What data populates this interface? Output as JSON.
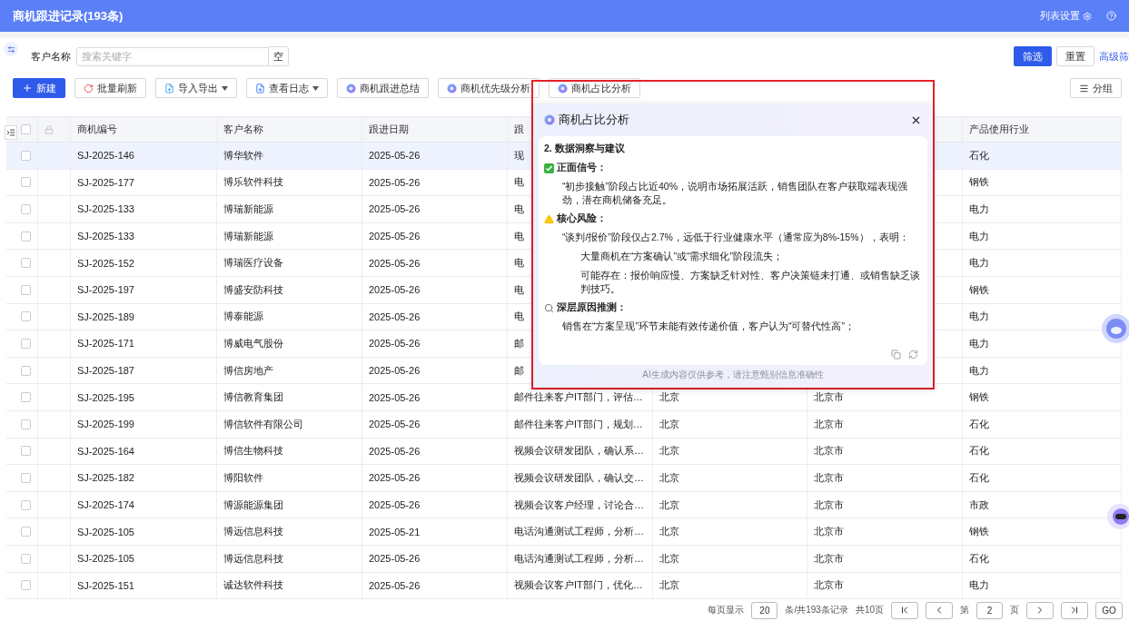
{
  "header": {
    "title": "商机跟进记录(193条)",
    "settings": "列表设置"
  },
  "filter": {
    "label": "客户名称",
    "placeholder": "搜索关键字",
    "clear": "空",
    "apply": "筛选",
    "reset": "重置",
    "advanced": "高级筛"
  },
  "toolbar": {
    "buttons": [
      {
        "kind": "primary",
        "label": "新建"
      },
      {
        "kind": "refresh",
        "label": "批量刷新"
      },
      {
        "kind": "import",
        "label": "导入导出",
        "menu": true
      },
      {
        "kind": "log",
        "label": "查看日志",
        "menu": true
      },
      {
        "kind": "ai",
        "label": "商机跟进总结"
      },
      {
        "kind": "ai",
        "label": "商机优先级分析"
      },
      {
        "kind": "ai",
        "label": "商机占比分析"
      }
    ],
    "group": "分组"
  },
  "table": {
    "header_checked": false,
    "columns": {
      "id": "商机编号",
      "customer": "客户名称",
      "date": "跟进日期",
      "column_4": "跟",
      "industry": "产品使用行业"
    },
    "rows": [
      {
        "checked": false,
        "selected": true,
        "id": "SJ-2025-146",
        "customer": "博华软件",
        "date": "2025-05-26",
        "column_4": "现",
        "industry": "石化"
      },
      {
        "checked": false,
        "selected": false,
        "id": "SJ-2025-177",
        "customer": "博乐软件科技",
        "date": "2025-05-26",
        "column_4": "电",
        "industry": "钢铁"
      },
      {
        "checked": false,
        "selected": false,
        "id": "SJ-2025-133",
        "customer": "博瑞新能源",
        "date": "2025-05-26",
        "column_4": "电",
        "industry": "电力"
      },
      {
        "checked": false,
        "selected": false,
        "id": "SJ-2025-133",
        "customer": "博瑞新能源",
        "date": "2025-05-26",
        "column_4": "电",
        "industry": "电力"
      },
      {
        "checked": false,
        "selected": false,
        "id": "SJ-2025-152",
        "customer": "博瑞医疗设备",
        "date": "2025-05-26",
        "column_4": "电",
        "industry": "电力"
      },
      {
        "checked": false,
        "selected": false,
        "id": "SJ-2025-197",
        "customer": "博盛安防科技",
        "date": "2025-05-26",
        "column_4": "电",
        "industry": "钢铁"
      },
      {
        "checked": false,
        "selected": false,
        "id": "SJ-2025-189",
        "customer": "博泰能源",
        "date": "2025-05-26",
        "column_4": "电",
        "industry": "电力"
      },
      {
        "checked": false,
        "selected": false,
        "id": "SJ-2025-171",
        "customer": "博威电气股份",
        "date": "2025-05-26",
        "column_4": "邮",
        "industry": "电力"
      },
      {
        "checked": false,
        "selected": false,
        "id": "SJ-2025-187",
        "customer": "博信房地产",
        "date": "2025-05-26",
        "column_4": "邮",
        "industry": "电力"
      },
      {
        "checked": false,
        "selected": false,
        "id": "SJ-2025-195",
        "customer": "博信教育集团",
        "date": "2025-05-26",
        "column_4": "邮件往来客户IT部门，评估…",
        "column_5": "北京",
        "column_6": "北京市",
        "industry": "钢铁"
      },
      {
        "checked": false,
        "selected": false,
        "id": "SJ-2025-199",
        "customer": "博信软件有限公司",
        "date": "2025-05-26",
        "column_4": "邮件往来客户IT部门，规划…",
        "column_5": "北京",
        "column_6": "北京市",
        "industry": "石化"
      },
      {
        "checked": false,
        "selected": false,
        "id": "SJ-2025-164",
        "customer": "博信生物科技",
        "date": "2025-05-26",
        "column_4": "视频会议研发团队，确认系…",
        "column_5": "北京",
        "column_6": "北京市",
        "industry": "石化"
      },
      {
        "checked": false,
        "selected": false,
        "id": "SJ-2025-182",
        "customer": "博阳软件",
        "date": "2025-05-26",
        "column_4": "视频会议研发团队，确认交…",
        "column_5": "北京",
        "column_6": "北京市",
        "industry": "石化"
      },
      {
        "checked": false,
        "selected": false,
        "id": "SJ-2025-174",
        "customer": "博源能源集团",
        "date": "2025-05-26",
        "column_4": "视频会议客户经理，讨论合…",
        "column_5": "北京",
        "column_6": "北京市",
        "industry": "市政"
      },
      {
        "checked": false,
        "selected": false,
        "id": "SJ-2025-105",
        "customer": "博远信息科技",
        "date": "2025-05-21",
        "column_4": "电话沟通测试工程师，分析…",
        "column_5": "北京",
        "column_6": "北京市",
        "industry": "钢铁"
      },
      {
        "checked": false,
        "selected": false,
        "id": "SJ-2025-105",
        "customer": "博远信息科技",
        "date": "2025-05-26",
        "column_4": "电话沟通测试工程师，分析…",
        "column_5": "北京",
        "column_6": "北京市",
        "industry": "石化"
      },
      {
        "checked": false,
        "selected": false,
        "id": "SJ-2025-151",
        "customer": "诚达软件科技",
        "date": "2025-05-26",
        "column_4": "视频会议客户IT部门，优化…",
        "column_5": "北京",
        "column_6": "北京市",
        "industry": "电力"
      }
    ]
  },
  "pagination": {
    "per_page_label": "每页显示",
    "per_page": "20",
    "total": "条/共193条记录",
    "pages": "共10页",
    "page_prefix": "第",
    "page": "2",
    "page_suffix": "页",
    "go": "GO"
  },
  "analysis_popup": {
    "title": "商机占比分析",
    "heading": "2. 数据洞察与建议",
    "sections": [
      {
        "kind": "positive",
        "title": "正面信号：",
        "paragraphs": [
          {
            "text": "“初步接触”阶段占比近40%，说明市场拓展活跃，销售团队在客户获取端表现强劲，潜在商机储备充足。"
          }
        ]
      },
      {
        "kind": "risk",
        "title": "核心风险：",
        "paragraphs": [
          {
            "text": "“谈判/报价”阶段仅占2.7%，远低于行业健康水平（通常应为8%-15%），表明：",
            "children": [
              {
                "text": "大量商机在“方案确认”或“需求细化”阶段流失；"
              },
              {
                "text": "可能存在：报价响应慢、方案缺乏针对性、客户决策链未打通、或销售缺乏谈判技巧。"
              }
            ]
          }
        ]
      },
      {
        "kind": "cause",
        "title": "深层原因推测：",
        "paragraphs": [
          {
            "text": "销售在“方案呈现”环节未能有效传递价值，客户认为“可替代性高”；"
          }
        ]
      }
    ],
    "disclaimer": "AI生成内容仅供参考，请注意甄别信息准确性"
  }
}
